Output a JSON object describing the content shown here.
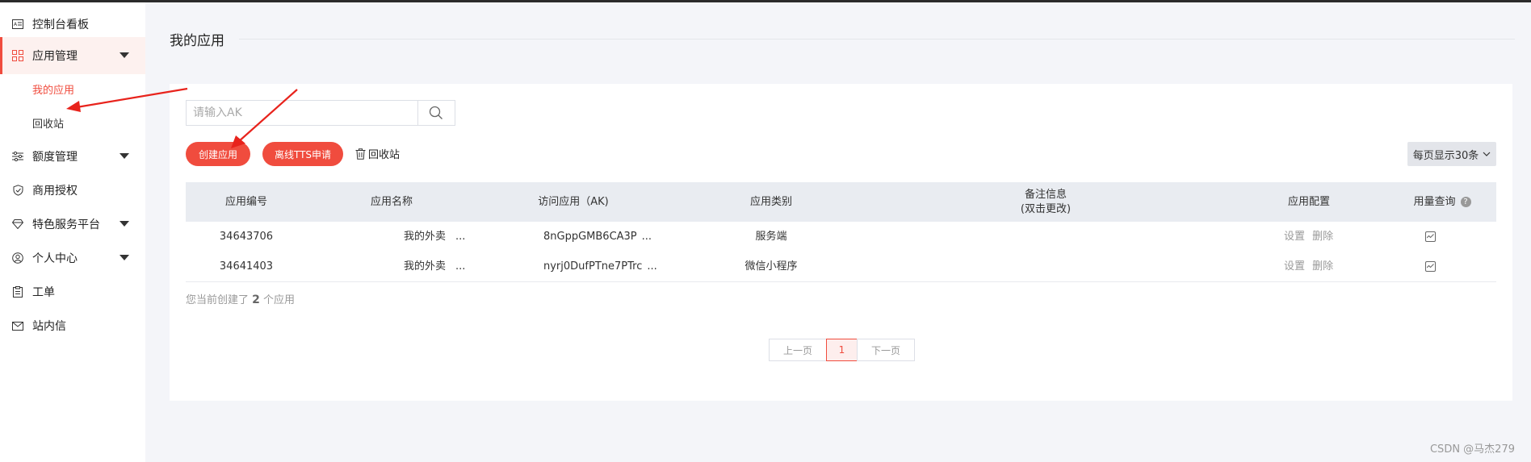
{
  "sidebar": {
    "items": [
      {
        "label": "控制台看板",
        "icon": "dashboard-card-icon"
      },
      {
        "label": "应用管理",
        "icon": "grid-icon"
      },
      {
        "label": "额度管理",
        "icon": "sliders-icon"
      },
      {
        "label": "商用授权",
        "icon": "shield-check-icon"
      },
      {
        "label": "特色服务平台",
        "icon": "diamond-icon"
      },
      {
        "label": "个人中心",
        "icon": "user-circle-icon"
      },
      {
        "label": "工单",
        "icon": "clipboard-icon"
      },
      {
        "label": "站内信",
        "icon": "mail-icon"
      }
    ],
    "sub_items": [
      {
        "label": "我的应用"
      },
      {
        "label": "回收站"
      }
    ]
  },
  "main": {
    "title": "我的应用",
    "search": {
      "placeholder": "请输入AK",
      "value": ""
    },
    "create_button": "创建应用",
    "offline_tts_button": "离线TTS申请",
    "recycle_link": "回收站",
    "page_size": "每页显示30条",
    "table": {
      "headers": [
        "应用编号",
        "应用名称",
        "访问应用（AK)",
        "应用类别",
        "备注信息",
        "(双击更改)",
        "应用配置",
        "用量查询"
      ],
      "rows": [
        {
          "id": "34643706",
          "name": "我的外卖",
          "name_more": "...",
          "ak": "8nGppGMB6CA3P",
          "ak_more": "...",
          "category": "服务端",
          "note": "",
          "settings": "设置",
          "delete": "删除"
        },
        {
          "id": "34641403",
          "name": "我的外卖",
          "name_more": "...",
          "ak": "nyrj0DufPTne7PTrc",
          "ak_more": "...",
          "category": "微信小程序",
          "note": "",
          "settings": "设置",
          "delete": "删除"
        }
      ]
    },
    "count": {
      "prefix": "您当前创建了",
      "num": "2",
      "suffix": "个应用"
    },
    "pagination": {
      "prev": "上一页",
      "current": "1",
      "next": "下一页"
    }
  },
  "watermark": "CSDN @马杰279",
  "colors": {
    "accent": "#f04c3e",
    "annotation_arrow": "#e8231c"
  }
}
